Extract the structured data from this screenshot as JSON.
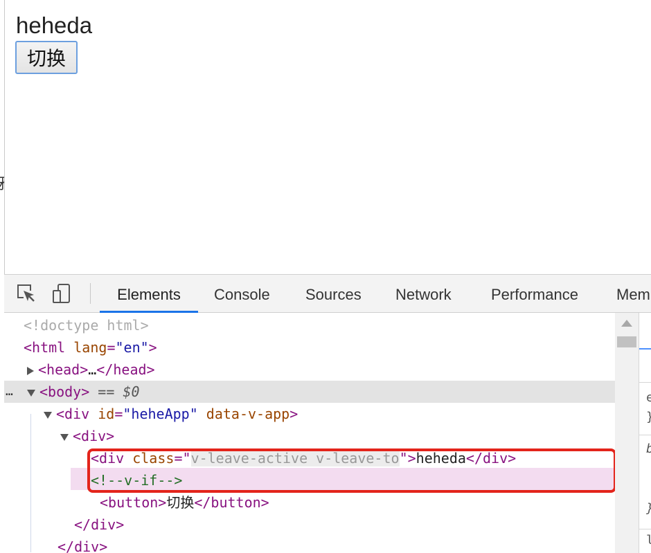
{
  "page": {
    "heading": "heheda",
    "toggle_button": "切换"
  },
  "devtools": {
    "tabs": [
      "Elements",
      "Console",
      "Sources",
      "Network",
      "Performance",
      "Mem"
    ],
    "active_tab": "Elements",
    "accent_color": "#1a73e8",
    "icons": [
      "inspect-element-icon",
      "device-toolbar-icon"
    ]
  },
  "dom": {
    "doctype": "<!doctype html>",
    "html_open": "<html",
    "html_lang_attr": "lang",
    "html_lang_val": "\"en\"",
    "html_close_bracket": ">",
    "head_open": "<head>",
    "head_ellipsis": "…",
    "head_close": "</head>",
    "ellipsis": "…",
    "body_tag": "<body>",
    "body_selected_note": " == $0",
    "div_app_open": "<div",
    "div_app_id_attr": "id",
    "div_app_id_val": "\"heheApp\"",
    "div_app_flag": "data-v-app",
    "div_app_close_bracket": ">",
    "div_open": "<div>",
    "inner_div_open": "<div",
    "inner_div_class_attr": "class",
    "inner_div_class_val": "v-leave-active v-leave-to",
    "inner_div_text": "heheda",
    "inner_div_close": "</div>",
    "comment": "<!--v-if-->",
    "button_open": "<button>",
    "button_text": "切换",
    "button_close": "</button>",
    "div_close_1": "</div>",
    "div_close_2": "</div>"
  },
  "side_panel": {
    "chars": [
      "e",
      "}",
      "b",
      "}",
      "l"
    ]
  },
  "highlight_color": "#e3241b"
}
